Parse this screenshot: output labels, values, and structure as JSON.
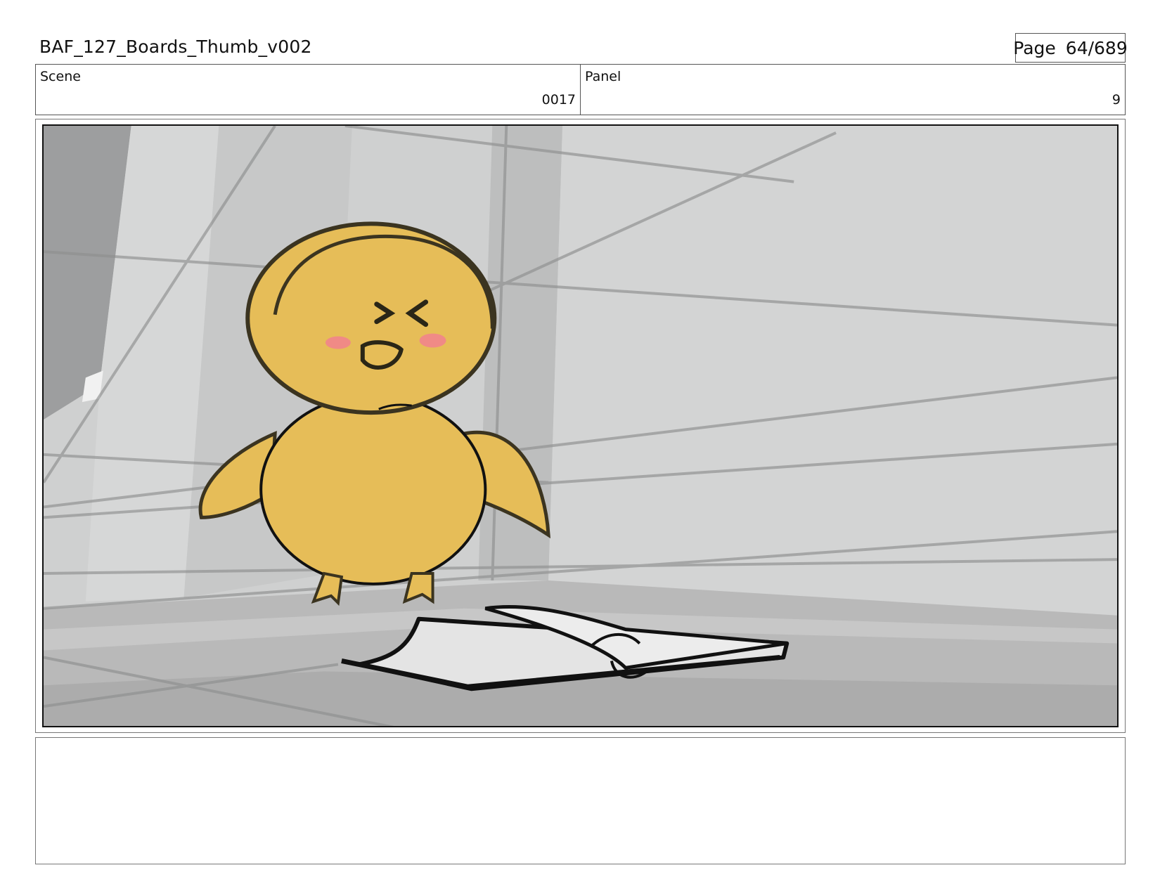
{
  "header": {
    "title": "BAF_127_Boards_Thumb_v002",
    "page_label": "Page",
    "page_number": "64/689"
  },
  "info": {
    "scene_label": "Scene",
    "scene_value": "0017",
    "panel_label": "Panel",
    "panel_value": "9"
  },
  "illustration": {
    "subject": "yellow chick character standing over an open book on the floor",
    "colors": {
      "background": "#cfd0d0",
      "chick_fill": "#e6bd58",
      "cheeks": "#f08a86",
      "book_pages": "#e4e4e4",
      "ink": "#111111"
    }
  },
  "notes": {
    "text": ""
  }
}
